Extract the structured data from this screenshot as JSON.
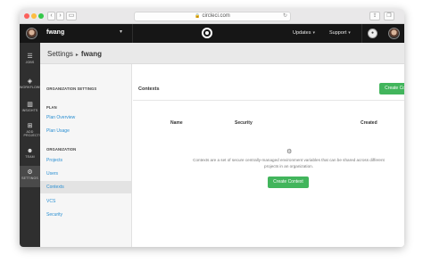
{
  "browser": {
    "url": "circleci.com",
    "lock_icon": "lock-icon"
  },
  "topbar": {
    "org_name": "fwang",
    "links": [
      {
        "label": "Updates"
      },
      {
        "label": "Support"
      }
    ]
  },
  "leftnav": {
    "items": [
      {
        "label": "JOBS",
        "icon": "jobs-icon",
        "glyph": "☰"
      },
      {
        "label": "WORKFLOWS",
        "icon": "workflows-icon",
        "glyph": "◈"
      },
      {
        "label": "INSIGHTS",
        "icon": "insights-icon",
        "glyph": "▥"
      },
      {
        "label": "ADD PROJECTS",
        "icon": "add-projects-icon",
        "glyph": "⊞"
      },
      {
        "label": "TEAM",
        "icon": "team-icon",
        "glyph": "☻"
      },
      {
        "label": "SETTINGS",
        "icon": "settings-icon",
        "glyph": "⚙"
      }
    ]
  },
  "header": {
    "section": "Settings",
    "org": "fwang"
  },
  "settings_nav": {
    "org_settings_heading": "ORGANIZATION SETTINGS",
    "plan_heading": "PLAN",
    "plan_links": [
      "Plan Overview",
      "Plan Usage"
    ],
    "org_heading": "ORGANIZATION",
    "org_links": [
      "Projects",
      "Users",
      "Contexts",
      "VCS",
      "Security"
    ]
  },
  "content": {
    "title": "Contexts",
    "create_button_label": "Create Context",
    "columns": [
      "Name",
      "Security",
      "Created"
    ],
    "empty_text": "Contexts are a set of secure centrally-managed environment variables that can be shared across different projects in an organization.",
    "empty_button_label": "Create Context"
  },
  "colors": {
    "accent_green": "#42b55c",
    "link_blue": "#2a8fd2",
    "topbar_bg": "#161616",
    "leftnav_bg": "#2f2f2f"
  }
}
